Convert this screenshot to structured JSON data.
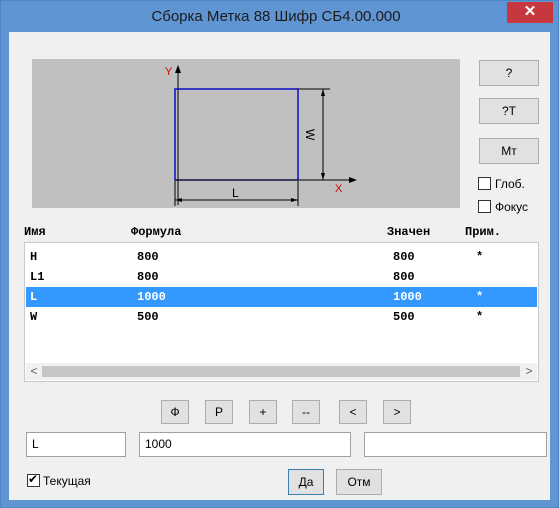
{
  "window": {
    "title": "Сборка Метка 88 Шифр СБ4.00.000",
    "close_label": "✕"
  },
  "preview": {
    "axis_y": "Y",
    "axis_x": "X",
    "dim_l": "L",
    "dim_w": "W"
  },
  "side_buttons": {
    "help": "?",
    "help_t": "?T",
    "mt": "Мт"
  },
  "checks": {
    "glob_label": "Глоб.",
    "focus_label": "Фокус",
    "glob_checked": false,
    "focus_checked": false
  },
  "table": {
    "columns": [
      "Имя",
      "Формула",
      "Значен",
      "Прим."
    ],
    "rows": [
      {
        "name": "H",
        "formula": "800",
        "value": "800",
        "note": "*",
        "selected": false
      },
      {
        "name": "L1",
        "formula": "800",
        "value": "800",
        "note": "",
        "selected": false
      },
      {
        "name": "L",
        "formula": "1000",
        "value": "1000",
        "note": "*",
        "selected": true
      },
      {
        "name": "W",
        "formula": "500",
        "value": "500",
        "note": "*",
        "selected": false
      }
    ],
    "scroll_left": "<",
    "scroll_right": ">"
  },
  "toolbar": {
    "phi": "Ф",
    "p": "Р",
    "plus": "+",
    "minus": "--",
    "prev": "<",
    "next": ">"
  },
  "edit": {
    "name_value": "L",
    "formula_value": "1000",
    "note_value": ""
  },
  "bottom": {
    "current_label": "Текущая",
    "current_checked": true,
    "ok": "Да",
    "cancel": "Отм"
  },
  "colors": {
    "title_bar": "#5f95d3",
    "close": "#c7373e",
    "selection": "#3399ff",
    "drawing_blue": "#0000cc"
  }
}
